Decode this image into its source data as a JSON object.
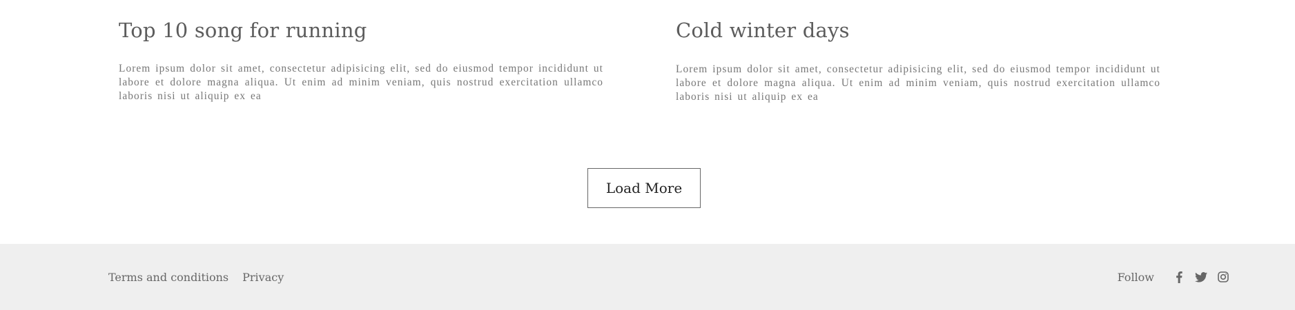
{
  "posts": [
    {
      "title": "Top 10 song for running",
      "excerpt": "Lorem ipsum dolor sit amet, consectetur adipisicing elit, sed do eiusmod tempor incididunt ut labore et dolore magna aliqua. Ut enim ad minim veniam, quis nostrud exercitation ullamco laboris nisi ut aliquip ex ea"
    },
    {
      "title": "Cold winter days",
      "excerpt": "Lorem ipsum dolor sit amet, consectetur adipisicing elit, sed do eiusmod tempor incididunt ut labore et dolore magna aliqua. Ut enim ad minim veniam, quis nostrud exercitation ullamco laboris nisi ut aliquip ex ea"
    }
  ],
  "load_more": {
    "label": "Load More"
  },
  "footer": {
    "links": [
      {
        "label": "Terms and conditions"
      },
      {
        "label": "Privacy"
      }
    ],
    "follow_label": "Follow",
    "social_icons": [
      "facebook-icon",
      "twitter-icon",
      "instagram-icon"
    ],
    "background_color": "#efefef",
    "text_color": "#666666"
  }
}
